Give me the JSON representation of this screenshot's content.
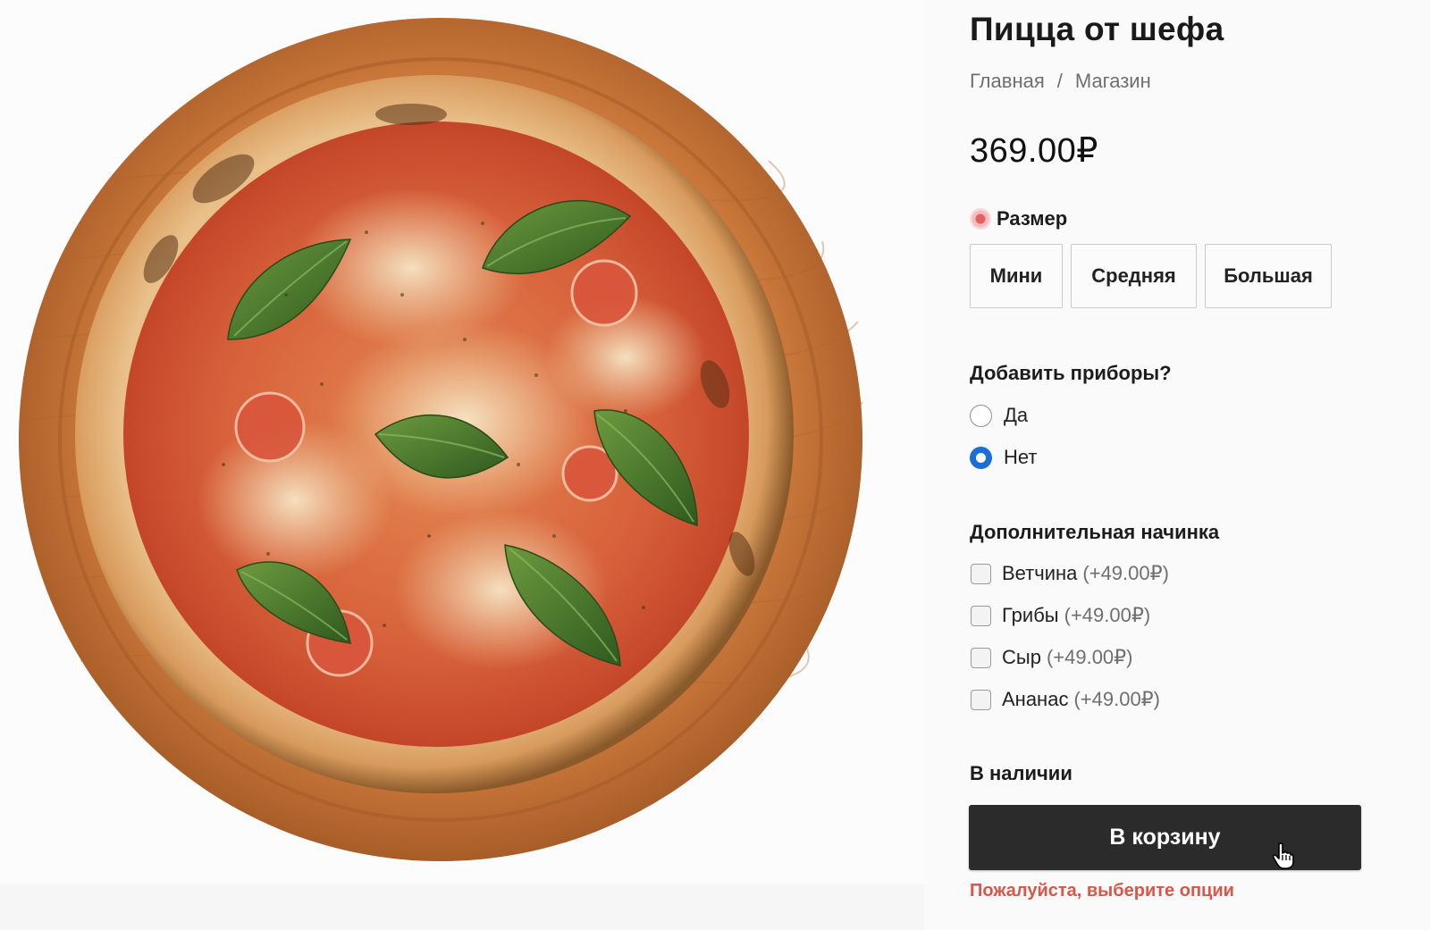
{
  "product": {
    "title": "Пицца от шефа",
    "price": "369.00₽",
    "image_alt": "pizza-photo"
  },
  "breadcrumb": {
    "home": "Главная",
    "separator": "/",
    "shop": "Магазин"
  },
  "size": {
    "label": "Размер",
    "options": [
      "Мини",
      "Средняя",
      "Большая"
    ]
  },
  "cutlery": {
    "label": "Добавить приборы?",
    "options": [
      {
        "label": "Да",
        "selected": false
      },
      {
        "label": "Нет",
        "selected": true
      }
    ]
  },
  "toppings": {
    "label": "Дополнительная начинка",
    "items": [
      {
        "name": "Ветчина",
        "price": "(+49.00₽)",
        "checked": false
      },
      {
        "name": "Грибы",
        "price": "(+49.00₽)",
        "checked": false
      },
      {
        "name": "Сыр",
        "price": "(+49.00₽)",
        "checked": false
      },
      {
        "name": "Ананас",
        "price": "(+49.00₽)",
        "checked": false
      }
    ]
  },
  "stock_status": "В наличии",
  "cart_button": "В корзину",
  "error_message": "Пожалуйста, выберите опции",
  "colors": {
    "accent": "#1a6ed8",
    "button_bg": "#2b2b2b",
    "error": "#d8564a",
    "board_wood": "#c8773a"
  }
}
